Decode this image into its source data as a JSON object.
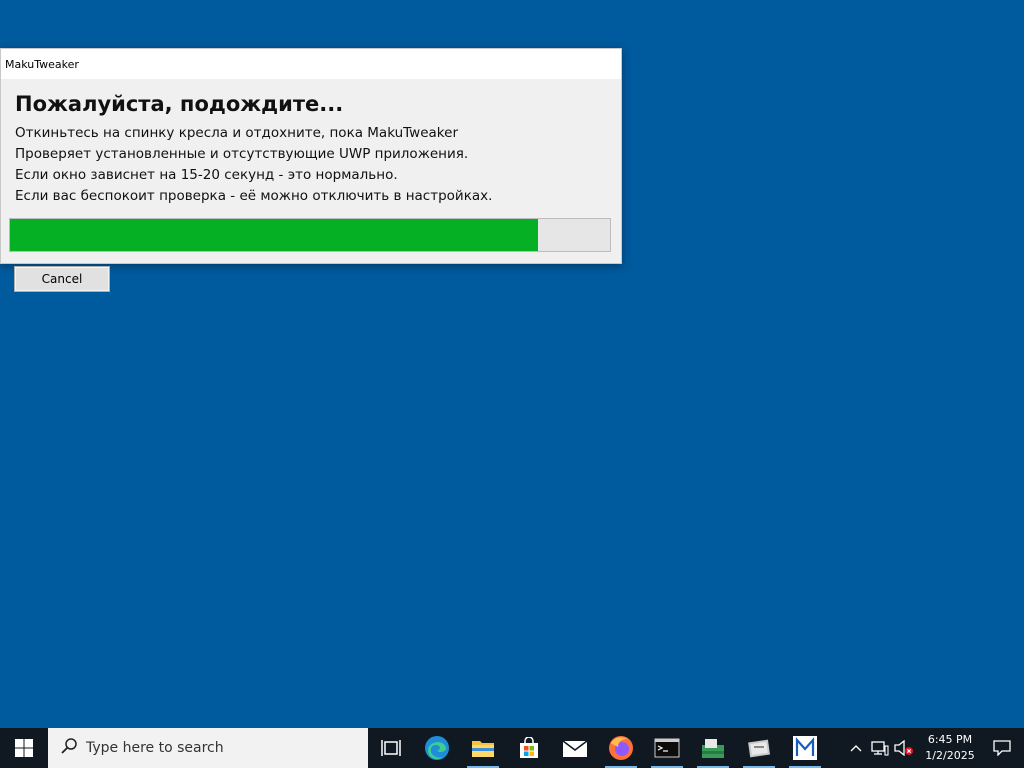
{
  "dialog": {
    "title": "MakuTweaker",
    "heading": "Пожалуйста, подождите...",
    "lines": [
      "Откиньтесь на спинку кресла и отдохните, пока MakuTweaker",
      "Проверяет установленные и отсутствующие UWP приложения.",
      "Если окно зависнет на 15-20 секунд - это нормально.",
      "Если вас беспокоит проверка - её можно отключить в настройках."
    ],
    "progress": 0.88,
    "progress_color": "#06b025",
    "cancel_label": "Cancel"
  },
  "desktop": {
    "background": "#005a9e"
  },
  "taskbar": {
    "search_placeholder": "Type here to search",
    "pinned": [
      {
        "name": "task-view-icon",
        "active": false
      },
      {
        "name": "edge-icon",
        "active": false
      },
      {
        "name": "file-explorer-icon",
        "active": true
      },
      {
        "name": "store-icon",
        "active": false
      },
      {
        "name": "mail-icon",
        "active": false
      },
      {
        "name": "firefox-icon",
        "active": true
      },
      {
        "name": "terminal-icon",
        "active": true
      },
      {
        "name": "app-green-icon",
        "active": true
      },
      {
        "name": "app-gray-icon",
        "active": true
      },
      {
        "name": "makutweaker-icon",
        "active": true
      }
    ],
    "clock": {
      "time": "6:45 PM",
      "date": "1/2/2025"
    }
  }
}
